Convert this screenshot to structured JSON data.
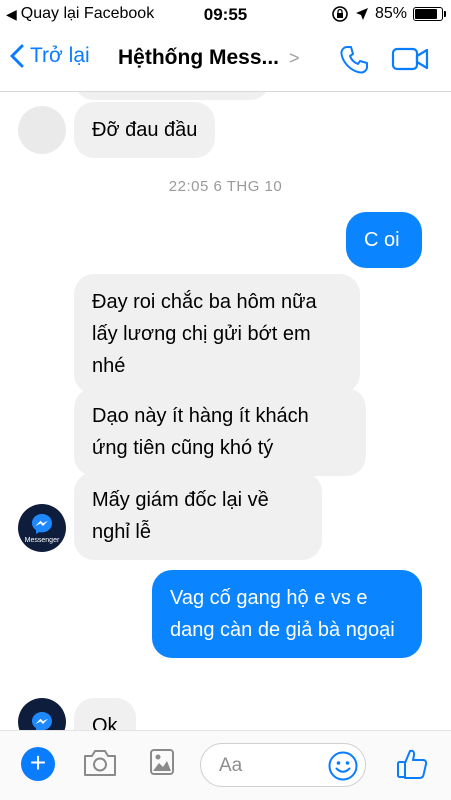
{
  "status_bar": {
    "back_label": "Quay lại Facebook",
    "time": "09:55",
    "battery_text": "85%",
    "battery_level": 0.85
  },
  "nav": {
    "back_label": "Trở lại",
    "title": "Hệthống Mess...",
    "accent_color": "#0a7cff"
  },
  "messages": [
    {
      "direction": "in",
      "text": "Đỡ đau đầu"
    },
    {
      "direction": "out",
      "text": "C oi"
    },
    {
      "direction": "in",
      "text": "Đay roi chắc ba hôm nữa lấy lương chị gửi bớt em nhé"
    },
    {
      "direction": "in",
      "text": "Dạo này ít hàng ít khách ứng tiên cũng khó tý"
    },
    {
      "direction": "in",
      "text": "Mấy giám đốc lại về nghỉ lễ"
    },
    {
      "direction": "out",
      "text": "Vag cố gang hộ e vs e dang càn de giả bà ngoại"
    },
    {
      "direction": "in",
      "text": "Ok"
    }
  ],
  "timestamp": "22:05 6 THG 10",
  "avatar_label": "Messenger",
  "composer": {
    "placeholder": "Aa"
  },
  "icons": [
    "plus-icon",
    "camera-icon",
    "image-icon",
    "emoji-icon",
    "thumbs-up-icon",
    "phone-icon",
    "video-icon",
    "back-chevron-icon"
  ]
}
